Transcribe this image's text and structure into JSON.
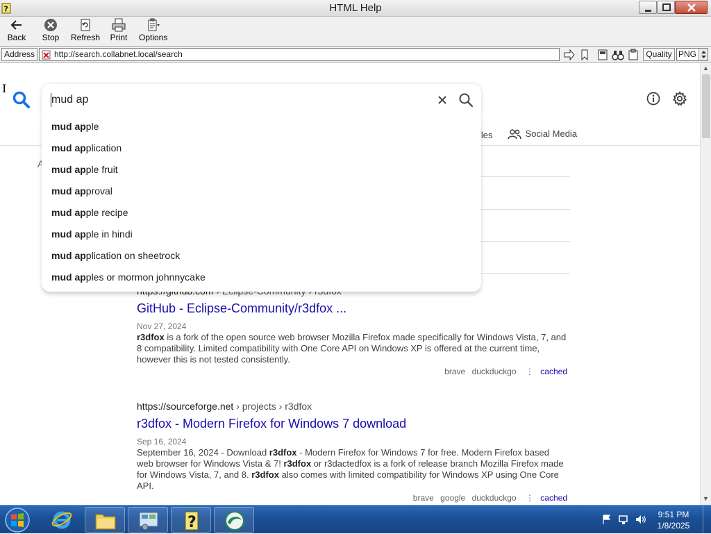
{
  "window": {
    "title": "HTML Help",
    "icon": "help-question-icon"
  },
  "toolbar": {
    "back_label": "Back",
    "stop_label": "Stop",
    "refresh_label": "Refresh",
    "print_label": "Print",
    "options_label": "Options"
  },
  "address": {
    "label": "Address",
    "url": "http://search.collabnet.local/search",
    "quality_label": "Quality",
    "quality_value": "PNG"
  },
  "search": {
    "query": "mud ap",
    "suggestions": [
      {
        "bold": "mud ap",
        "rest": "ple"
      },
      {
        "bold": "mud ap",
        "rest": "plication"
      },
      {
        "bold": "mud ap",
        "rest": "ple fruit"
      },
      {
        "bold": "mud ap",
        "rest": "proval"
      },
      {
        "bold": "mud ap",
        "rest": "ple recipe"
      },
      {
        "bold": "mud ap",
        "rest": "ple in hindi"
      },
      {
        "bold": "mud ap",
        "rest": "plication on sheetrock"
      },
      {
        "bold": "mud ap",
        "rest": "ples or mormon johnnycake"
      }
    ]
  },
  "tabs": {
    "files_partial": "iles",
    "social": "Social Media"
  },
  "stray_text": "A",
  "results": [
    {
      "domain": "https://github.com",
      "path": "› Eclipse-Community › r3dfox",
      "title": "GitHub - Eclipse-Community/r3dfox ...",
      "date": "Nov 27, 2024",
      "snippet": {
        "b1": "r3dfox",
        "t1": " is a fork of the open source web browser Mozilla Firefox made specifically for Windows Vista, 7, and 8 compatibility. Limited compatibility with One Core API on Windows XP is offered at the current time, however this is not tested consistently."
      },
      "engines": [
        "brave",
        "duckduckgo"
      ],
      "cached": "cached"
    },
    {
      "domain": "https://sourceforge.net",
      "path": "› projects › r3dfox",
      "title": "r3dfox - Modern Firefox for Windows 7 download",
      "date": "Sep 16, 2024",
      "snippet": {
        "t0": "September 16, 2024 - Download ",
        "b1": "r3dfox",
        "t1": " - Modern Firefox for Windows 7 for free. Modern Firefox based web browser for Windows Vista & 7! ",
        "b2": "r3dfox",
        "t2": " or r3dactedfox is a fork of release branch Mozilla Firefox made for Windows Vista, 7, and 8. ",
        "b3": "r3dfox",
        "t3": " also comes with limited compatibility for Windows XP using One Core API."
      },
      "engines": [
        "brave",
        "google",
        "duckduckgo"
      ],
      "cached": "cached"
    }
  ],
  "taskbar": {
    "time": "9:51 PM",
    "date": "1/8/2025",
    "items": [
      "internet-explorer-icon",
      "file-explorer-icon",
      "control-panel-icon",
      "help-question-icon",
      "browser-app-icon"
    ]
  },
  "colors": {
    "link": "#1a0dab",
    "search_logo": "#1a73e8",
    "taskbar": "#1b4f95"
  }
}
